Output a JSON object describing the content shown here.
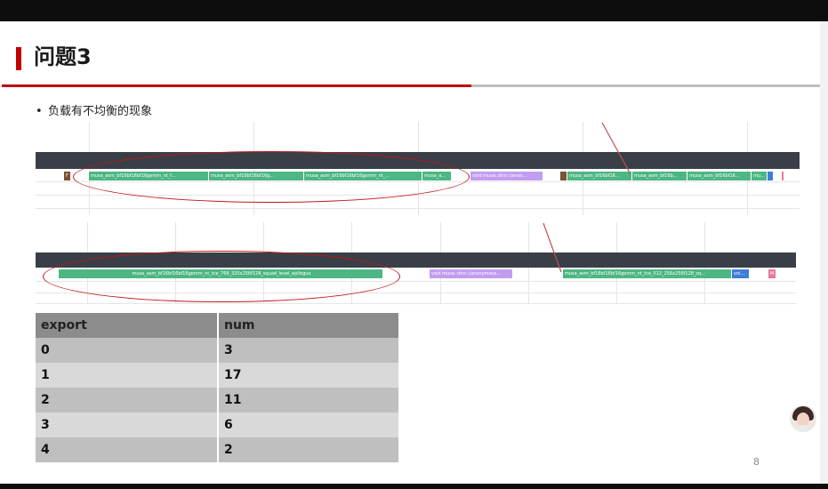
{
  "slide": {
    "title": "问题3",
    "bullet": "负载有不均衡的现象",
    "page_number": "8"
  },
  "trace1": {
    "blocks": [
      {
        "label": "F",
        "color": "brown"
      },
      {
        "label": "musa_asm_bf16bf16bf16gemm_nt_t...",
        "color": "green"
      },
      {
        "label": "musa_asm_bf16bf16bf16g...",
        "color": "green"
      },
      {
        "label": "musa_asm_bf16bf16bf16gemm_nt_...",
        "color": "green"
      },
      {
        "label": "musa_a...",
        "color": "green"
      },
      {
        "label": "void musa::dnn::(anon...",
        "color": "purple"
      },
      {
        "label": "",
        "color": "brown"
      },
      {
        "label": "musa_asm_bf16bf16...",
        "color": "green"
      },
      {
        "label": "musa_asm_bf16b...",
        "color": "green"
      },
      {
        "label": "musa_asm_bf16bf16...",
        "color": "green"
      },
      {
        "label": "mu...",
        "color": "green"
      }
    ]
  },
  "trace2": {
    "blocks": [
      {
        "label": "musa_asm_bf16bf16bf16gemm_nt_tce_768_320x256f128_squad_level_epilogue",
        "color": "green"
      },
      {
        "label": "void musa::dnn::(anonymous...",
        "color": "purple"
      },
      {
        "label": "musa_asm_bf16bf16bf16gemm_nt_tce_512_256x256f128_sq...",
        "color": "green"
      },
      {
        "label": "voi...",
        "color": "blue"
      },
      {
        "label": "M",
        "color": "pink"
      }
    ]
  },
  "table": {
    "headers": [
      "export",
      "num"
    ],
    "rows": [
      [
        "0",
        "3"
      ],
      [
        "1",
        "17"
      ],
      [
        "2",
        "11"
      ],
      [
        "3",
        "6"
      ],
      [
        "4",
        "2"
      ]
    ]
  }
}
